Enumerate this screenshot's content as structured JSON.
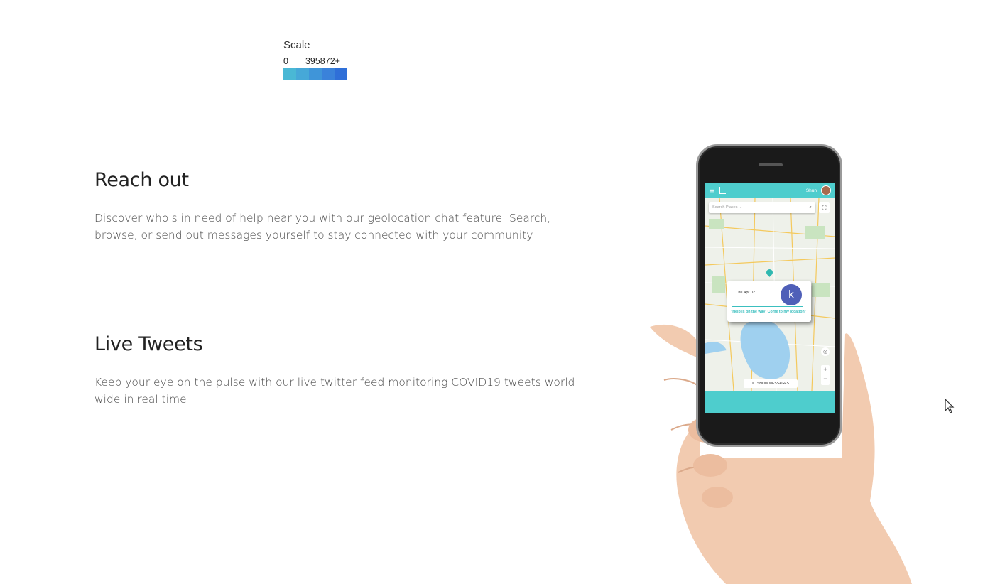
{
  "scale": {
    "title": "Scale",
    "min_label": "0",
    "max_label": "395872+",
    "colors": [
      "#4ab8d5",
      "#46a8d8",
      "#3f95d9",
      "#3a82da",
      "#2f6fd8"
    ]
  },
  "features": [
    {
      "heading": "Reach out",
      "body": "Discover who's in need of help near you with our geolocation chat feature. Search, browse, or send out messages yourself to stay connected with your community"
    },
    {
      "heading": "Live Tweets",
      "body": "Keep your eye on the pulse with our live twitter feed monitoring COVID19 tweets world wide in real time"
    }
  ],
  "phone": {
    "user_name": "Shun",
    "search_placeholder": "Search Places ...",
    "popup": {
      "date": "Thu Apr 02",
      "avatar_letter": "k",
      "message": "\"Help is on the way! Come to my location\""
    },
    "show_messages_label": "SHOW MESSAGES",
    "zoom_in": "+",
    "zoom_out": "−",
    "accent_color": "#4ecdcd"
  },
  "icons": {
    "menu": "menu-icon",
    "search": "search-icon",
    "fullscreen": "fullscreen-icon",
    "locate": "locate-icon",
    "cursor": "cursor-icon"
  }
}
